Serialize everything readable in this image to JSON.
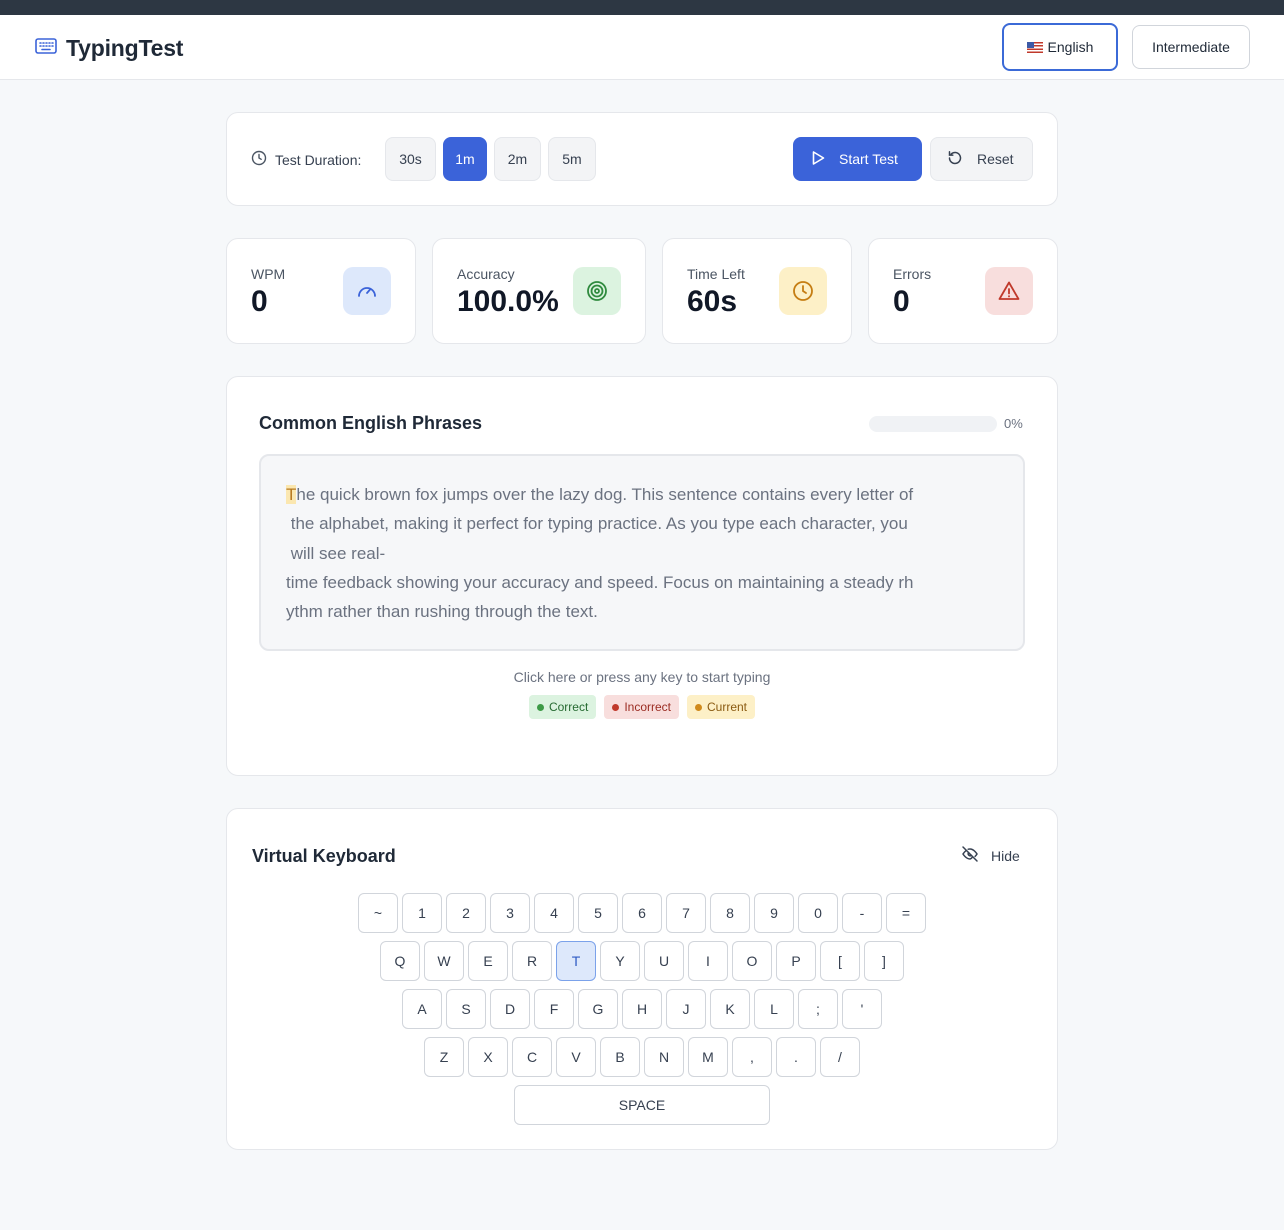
{
  "header": {
    "app_title": "TypingTest",
    "language_button": "English",
    "level_button": "Intermediate"
  },
  "controls": {
    "duration_label": "Test Duration:",
    "durations": [
      "30s",
      "1m",
      "2m",
      "5m"
    ],
    "active_duration": "1m",
    "start_label": "Start Test",
    "reset_label": "Reset"
  },
  "stats": {
    "wpm": {
      "label": "WPM",
      "value": "0"
    },
    "accuracy": {
      "label": "Accuracy",
      "value": "100.0%"
    },
    "time_left": {
      "label": "Time Left",
      "value": "60s"
    },
    "errors": {
      "label": "Errors",
      "value": "0"
    }
  },
  "passage": {
    "title": "Common English Phrases",
    "progress_percent": 0,
    "progress_label": "0%",
    "current_char": "T",
    "lines": [
      "he quick brown fox jumps over the lazy dog. This sentence contains every letter of",
      " the alphabet, making it perfect for typing practice. As you type each character, you",
      " will see real-",
      "time feedback showing your accuracy and speed. Focus on maintaining a steady rh",
      "ythm rather than rushing through the text."
    ],
    "hint": "Click here or press any key to start typing",
    "legend": {
      "correct": "Correct",
      "incorrect": "Incorrect",
      "current": "Current"
    }
  },
  "keyboard": {
    "title": "Virtual Keyboard",
    "hide_label": "Hide",
    "active_key": "T",
    "rows": [
      [
        "~",
        "1",
        "2",
        "3",
        "4",
        "5",
        "6",
        "7",
        "8",
        "9",
        "0",
        "-",
        "="
      ],
      [
        "Q",
        "W",
        "E",
        "R",
        "T",
        "Y",
        "U",
        "I",
        "O",
        "P",
        "[",
        "]"
      ],
      [
        "A",
        "S",
        "D",
        "F",
        "G",
        "H",
        "J",
        "K",
        "L",
        ";",
        "'"
      ],
      [
        "Z",
        "X",
        "C",
        "V",
        "B",
        "N",
        "M",
        ",",
        ".",
        "/"
      ]
    ],
    "space_label": "SPACE"
  },
  "colors": {
    "accent": "#3b63d9",
    "correct": "#3d9a46",
    "incorrect": "#c0392b",
    "current": "#d08a1c"
  },
  "icons": {
    "brand": "keyboard-icon",
    "duration": "clock-icon",
    "start": "play-icon",
    "reset": "rotate-ccw-icon",
    "wpm": "gauge-icon",
    "accuracy": "target-icon",
    "time_left": "clock-icon",
    "errors": "alert-triangle-icon",
    "hide": "eye-off-icon"
  }
}
